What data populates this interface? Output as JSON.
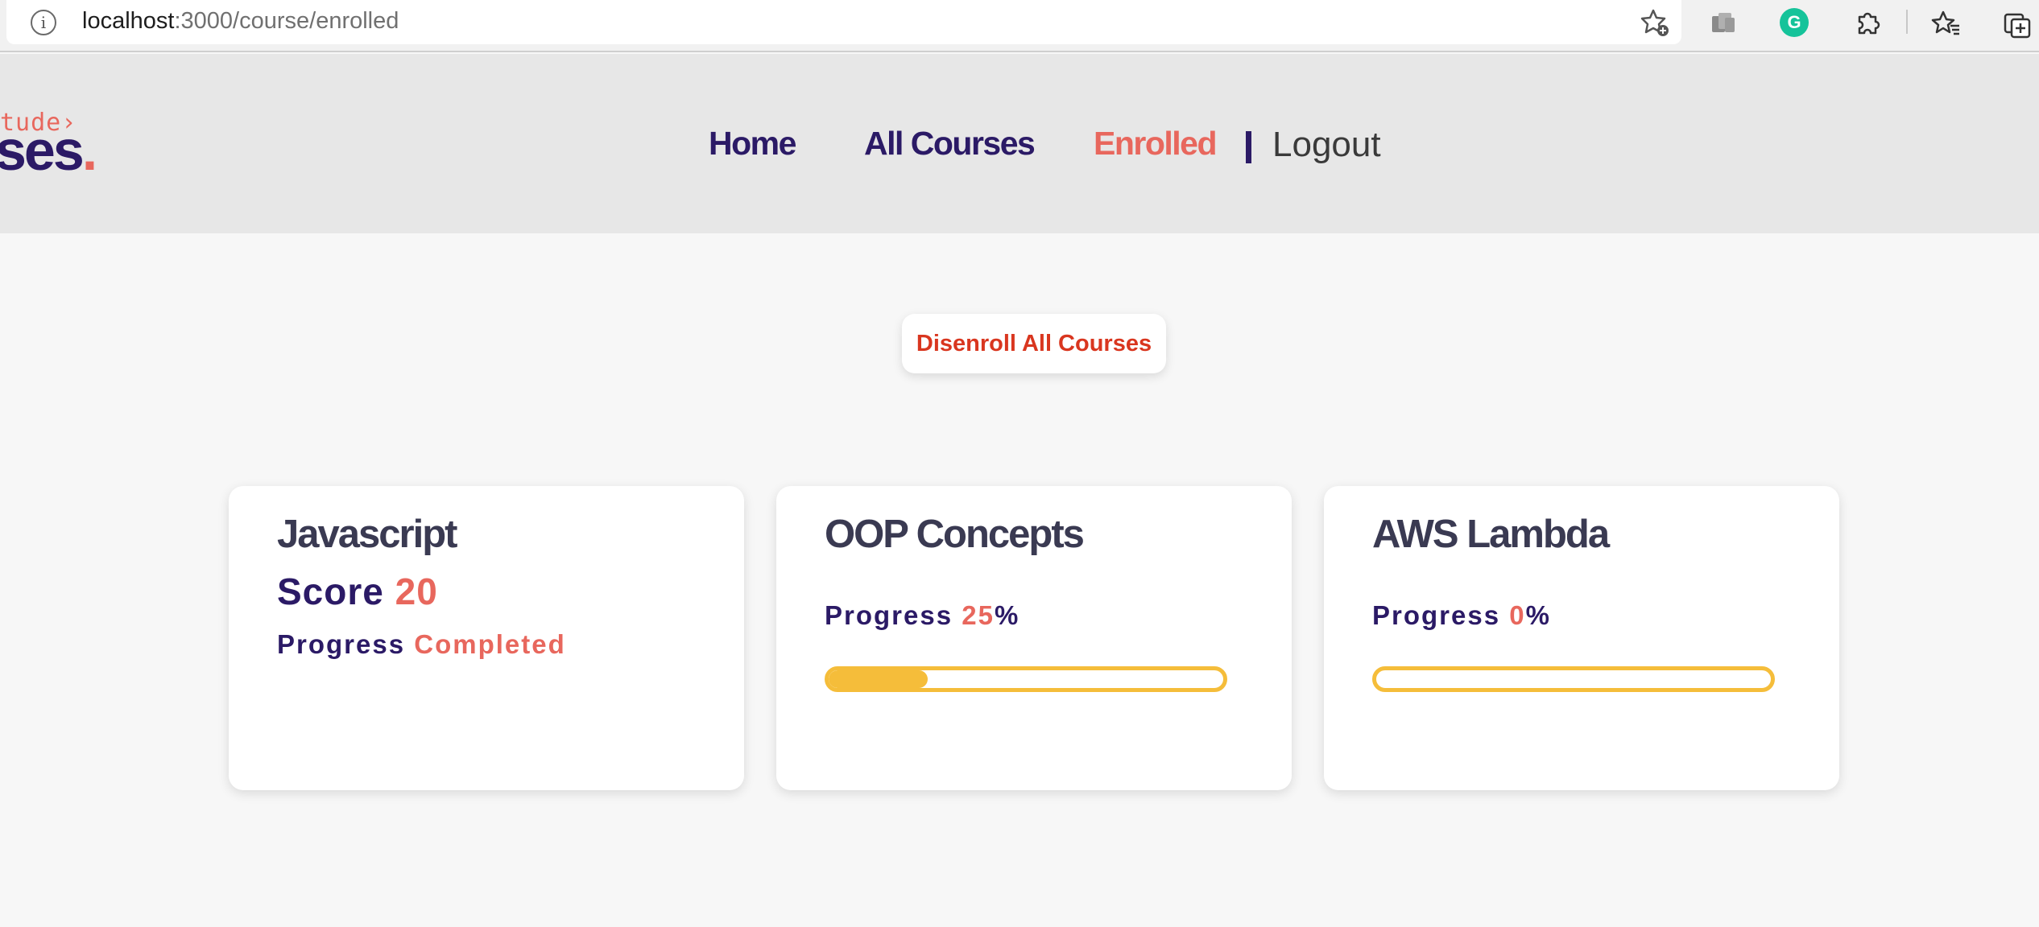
{
  "browser": {
    "url_host": "localhost",
    "url_path": ":3000/course/enrolled"
  },
  "header": {
    "logo_small": "tude",
    "logo_small_chevron": "›",
    "logo_big": "ses",
    "logo_dot": ".",
    "nav": {
      "home": "Home",
      "all_courses": "All Courses",
      "enrolled": "Enrolled",
      "logout": "Logout"
    }
  },
  "main": {
    "disenroll_label": "Disenroll All Courses",
    "courses": [
      {
        "title": "Javascript",
        "score_label": "Score",
        "score_value": "20",
        "progress_label": "Progress",
        "progress_value": "Completed"
      },
      {
        "title": "OOP Concepts",
        "progress_label": "Progress",
        "progress_value": "25",
        "progress_suffix": "%",
        "progress_fraction": 0.25
      },
      {
        "title": "AWS Lambda",
        "progress_label": "Progress",
        "progress_value": "0",
        "progress_suffix": "%",
        "progress_fraction": 0
      }
    ]
  },
  "colors": {
    "navy": "#2b1a66",
    "coral": "#e8675d",
    "progress_yellow": "#f5bd3a",
    "disenroll_red": "#d9361f"
  },
  "icons": [
    "info-icon",
    "star-add-icon",
    "collections-icon",
    "grammarly-icon",
    "puzzle-extension-icon",
    "favorites-icon",
    "add-tab-icon"
  ]
}
